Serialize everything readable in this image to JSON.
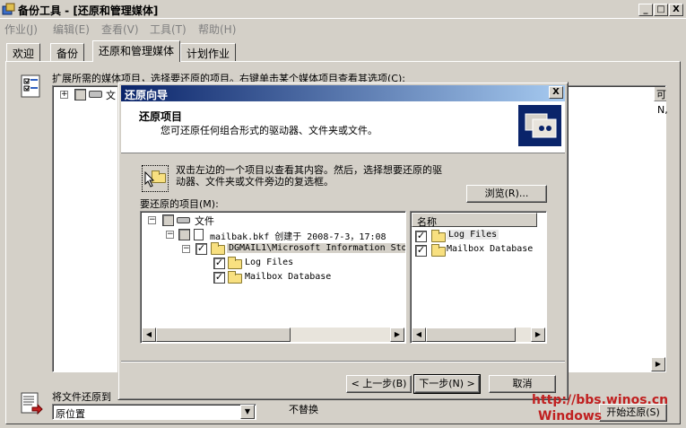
{
  "window": {
    "title": "备份工具 - [还原和管理媒体]",
    "buttons": [
      "_",
      "□",
      "X"
    ]
  },
  "menu": [
    {
      "label": "作业(J)"
    },
    {
      "label": "编辑(E)"
    },
    {
      "label": "查看(V)"
    },
    {
      "label": "工具(T)"
    },
    {
      "label": "帮助(H)"
    }
  ],
  "tabs": [
    {
      "label": "欢迎"
    },
    {
      "label": "备份"
    },
    {
      "label": "还原和管理媒体"
    },
    {
      "label": "计划作业"
    }
  ],
  "main": {
    "instruction": "扩展所需的媒体项目，选择要还原的项目。右键单击某个媒体项目查看其选项(C):",
    "tree_root_label": "文",
    "right_col_header": "可",
    "right_col_value": "N,",
    "restore_to_label": "将文件还原到",
    "restore_to_value": "原位置",
    "replace_label": "不替换",
    "start_restore_label": "开始还原(S)"
  },
  "dialog": {
    "title": "还原向导",
    "close_glyph": "X",
    "header_title": "还原项目",
    "header_subtitle": "您可还原任何组合形式的驱动器、文件夹或文件。",
    "hint_line1": "双击左边的一个项目以查看其内容。然后，选择想要还原的驱",
    "hint_line2": "动器、文件夹或文件旁边的复选框。",
    "browse_label": "浏览(R)...",
    "items_label": "要还原的项目(M):",
    "tree": [
      {
        "label": "文件"
      },
      {
        "label": "mailbak.bkf 创建于 2008-7-3，17:08"
      },
      {
        "label": "DGMAIL1\\Microsoft Information Sto"
      },
      {
        "label": "Log Files"
      },
      {
        "label": "Mailbox Database"
      }
    ],
    "list_header": "名称",
    "list": [
      {
        "label": "Log Files"
      },
      {
        "label": "Mailbox Database"
      }
    ],
    "back_label": "< 上一步(B)",
    "next_label": "下一步(N) >",
    "cancel_label": "取消"
  },
  "watermark": {
    "line1": "http://bbs.winos.cn",
    "line2": "Windows"
  },
  "colors": {
    "face": "#d4d0c8",
    "title_gradient_start": "#0a246a",
    "title_gradient_end": "#a6caf0",
    "watermark": "#c02020"
  }
}
